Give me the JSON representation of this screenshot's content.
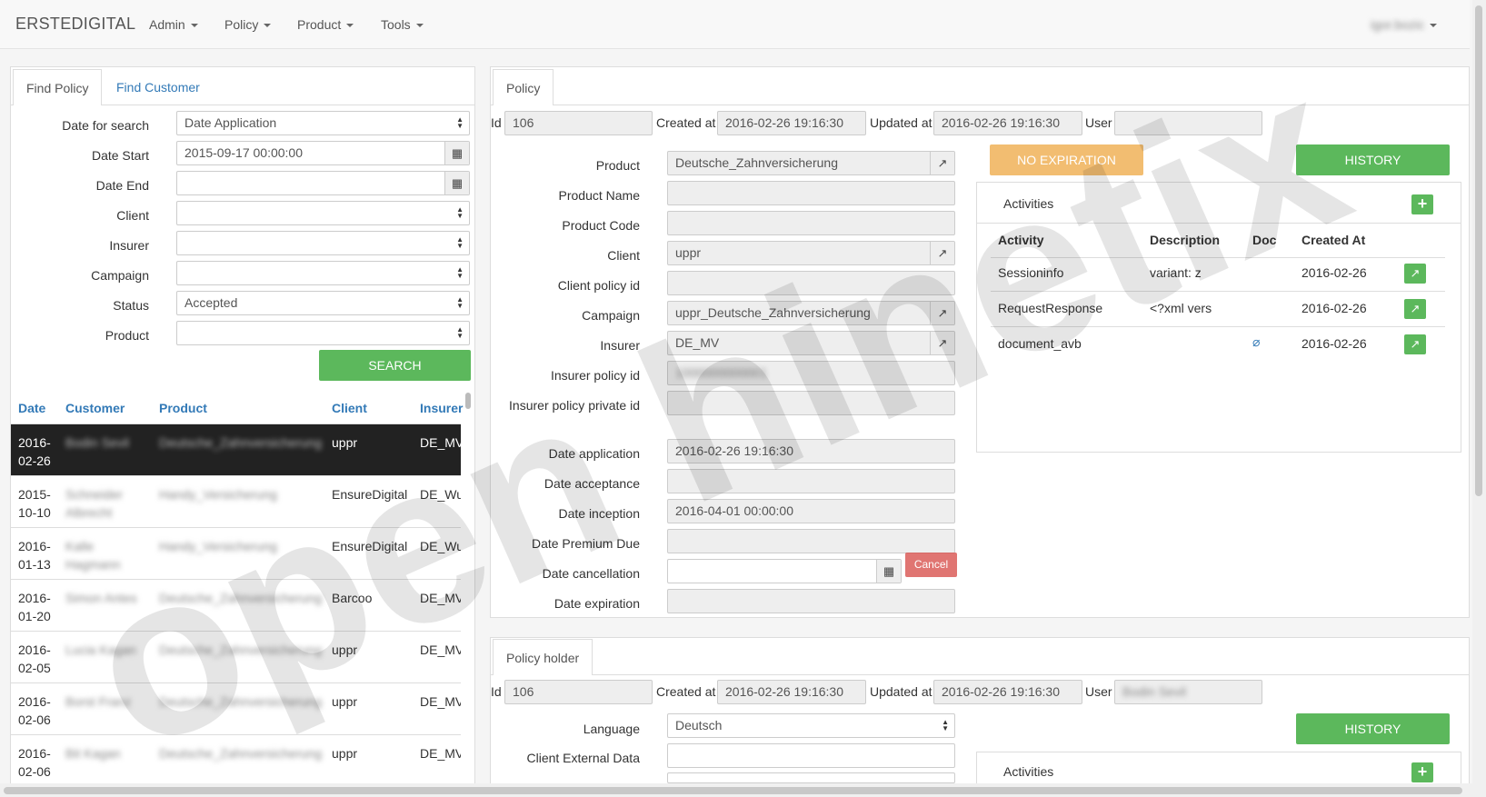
{
  "nav": {
    "brand": "ERSTEDIGITAL",
    "menus": [
      "Admin",
      "Policy",
      "Product",
      "Tools"
    ],
    "user": "igor.bozic"
  },
  "search": {
    "tabs": [
      "Find Policy",
      "Find Customer"
    ],
    "labels": {
      "date_for_search": "Date for search",
      "date_start": "Date Start",
      "date_end": "Date End",
      "client": "Client",
      "insurer": "Insurer",
      "campaign": "Campaign",
      "status": "Status",
      "product": "Product"
    },
    "values": {
      "date_for_search": "Date Application",
      "date_start": "2015-09-17 00:00:00",
      "date_end": "",
      "client": "",
      "insurer": "",
      "campaign": "",
      "status": "Accepted",
      "product": ""
    },
    "search_button": "SEARCH"
  },
  "results": {
    "headers": [
      "Date",
      "Customer",
      "Product",
      "Client",
      "Insurer"
    ],
    "rows": [
      {
        "date1": "2016-",
        "date2": "02-26",
        "customer": "Bodin Sevil",
        "product": "Deutsche_Zahnversicherung",
        "client": "uppr",
        "insurer": "DE_MV"
      },
      {
        "date1": "2015-",
        "date2": "10-10",
        "customer": "Schneider Albrecht",
        "product": "Handy_Versicherung",
        "client": "EnsureDigital",
        "insurer": "DE_Wue"
      },
      {
        "date1": "2016-",
        "date2": "01-13",
        "customer": "Kalle Hagmann",
        "product": "Handy_Versicherung",
        "client": "EnsureDigital",
        "insurer": "DE_Wue"
      },
      {
        "date1": "2016-",
        "date2": "01-20",
        "customer": "Simon Antes",
        "product": "Deutsche_Zahnversicherung",
        "client": "Barcoo",
        "insurer": "DE_MV"
      },
      {
        "date1": "2016-",
        "date2": "02-05",
        "customer": "Lucia Kagan",
        "product": "Deutsche_Zahnversicherung",
        "client": "uppr",
        "insurer": "DE_MV"
      },
      {
        "date1": "2016-",
        "date2": "02-06",
        "customer": "Borst Franz",
        "product": "Deutsche_Zahnversicherung",
        "client": "uppr",
        "insurer": "DE_MV"
      },
      {
        "date1": "2016-",
        "date2": "02-06",
        "customer": "Bit Kagan",
        "product": "Deutsche_Zahnversicherung",
        "client": "uppr",
        "insurer": "DE_MV"
      }
    ]
  },
  "policy": {
    "tab": "Policy",
    "id_label": "Id",
    "id": "106",
    "created_label": "Created at",
    "created": "2016-02-26 19:16:30",
    "updated_label": "Updated at",
    "updated": "2016-02-26 19:16:30",
    "user_label": "User",
    "user": "",
    "labels": {
      "product": "Product",
      "product_name": "Product Name",
      "product_code": "Product Code",
      "client": "Client",
      "client_policy_id": "Client policy id",
      "campaign": "Campaign",
      "insurer": "Insurer",
      "insurer_policy_id": "Insurer policy id",
      "insurer_policy_private_id": "Insurer policy private id",
      "date_application": "Date application",
      "date_acceptance": "Date acceptance",
      "date_inception": "Date inception",
      "date_premium_due": "Date Premium Due",
      "date_cancellation": "Date cancellation",
      "date_expiration": "Date expiration"
    },
    "values": {
      "product": "Deutsche_Zahnversicherung",
      "product_name": "",
      "product_code": "",
      "client": "uppr",
      "client_policy_id": "",
      "campaign": "uppr_Deutsche_Zahnversicherung",
      "insurer": "DE_MV",
      "insurer_policy_id": "1000000000001",
      "insurer_policy_private_id": "",
      "date_application": "2016-02-26 19:16:30",
      "date_acceptance": "",
      "date_inception": "2016-04-01 00:00:00",
      "date_premium_due": "",
      "date_cancellation": "",
      "date_expiration": ""
    },
    "no_expiration": "NO EXPIRATION",
    "history": "HISTORY",
    "cancel": "Cancel"
  },
  "activities": {
    "title": "Activities",
    "headers": [
      "Activity",
      "Description",
      "Doc",
      "Created At"
    ],
    "rows": [
      {
        "activity": "Sessioninfo",
        "description": "variant: z",
        "created": "2016-02-26"
      },
      {
        "activity": "RequestResponse",
        "description": "<?xml vers",
        "created": "2016-02-26"
      },
      {
        "activity": "document_avb",
        "description": "",
        "created": "2016-02-26"
      }
    ]
  },
  "holder": {
    "tab": "Policy holder",
    "id_label": "Id",
    "id": "106",
    "created_label": "Created at",
    "created": "2016-02-26 19:16:30",
    "updated_label": "Updated at",
    "updated": "2016-02-26 19:16:30",
    "user_label": "User",
    "user": "Bodin Sevil",
    "language_label": "Language",
    "language": "Deutsch",
    "client_external_label": "Client External Data",
    "history": "HISTORY",
    "activities_title": "Activities"
  },
  "watermark": "open hinetix"
}
